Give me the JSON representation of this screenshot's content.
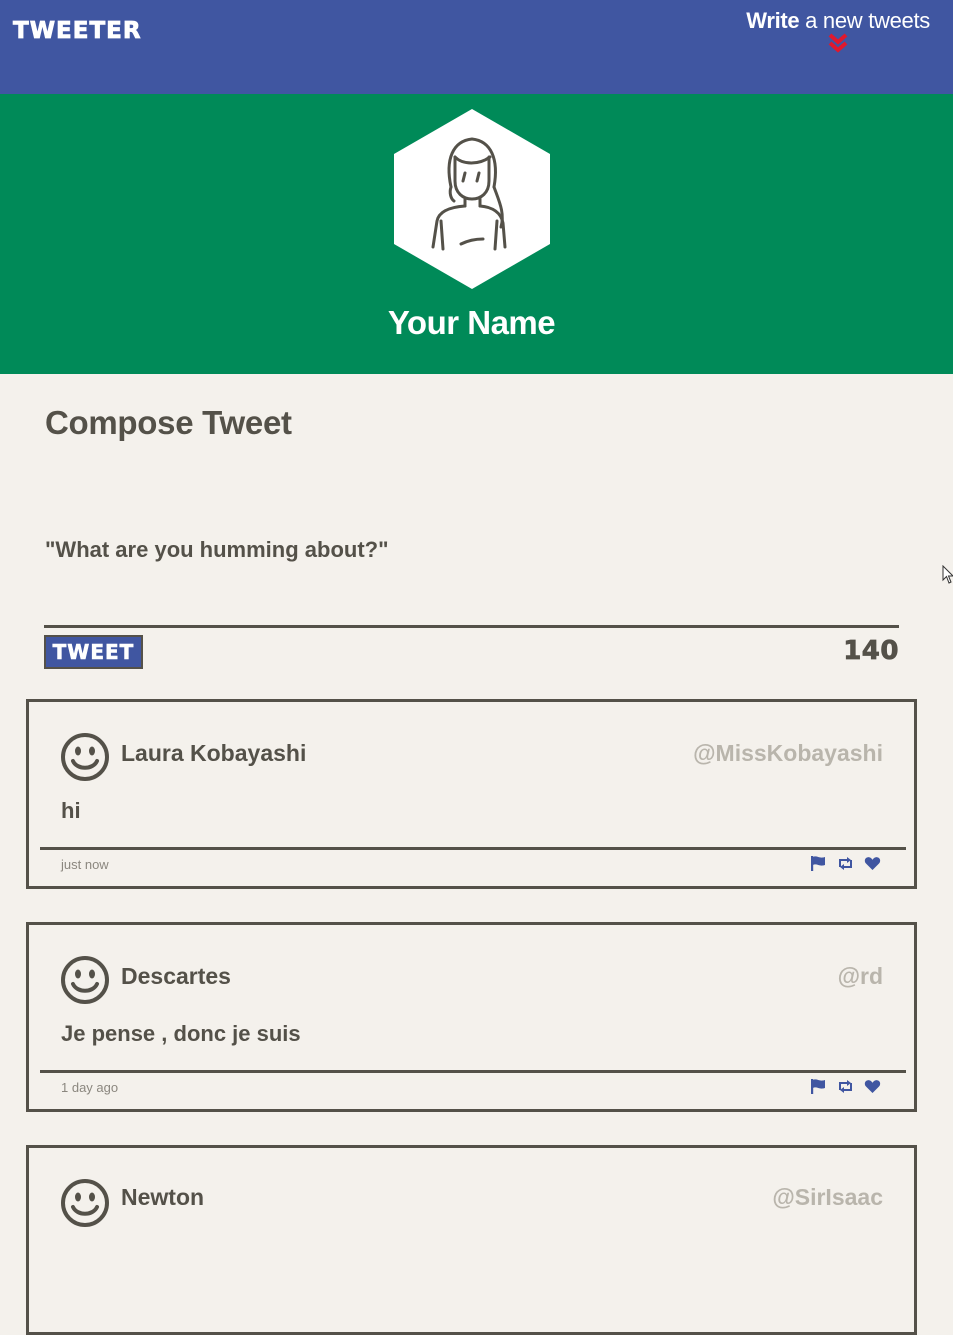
{
  "nav": {
    "brand": "TWEETER",
    "write_bold": "Write",
    "write_rest": " a new tweets",
    "chevron_icon": "double-chevron-down-icon",
    "background": "#4056a1"
  },
  "profile": {
    "name": "Your Name",
    "avatar_icon": "user-avatar-icon",
    "background": "#008a58"
  },
  "compose": {
    "title": "Compose Tweet",
    "placeholder": "\"What are you humming about?\"",
    "button_label": "TWEET",
    "counter": "140"
  },
  "tweets": [
    {
      "name": "Laura Kobayashi",
      "handle": "@MissKobayashi",
      "content": "hi",
      "time": "just now",
      "avatar_icon": "smiley-icon"
    },
    {
      "name": "Descartes",
      "handle": "@rd",
      "content": "Je pense , donc je suis",
      "time": "1 day ago",
      "avatar_icon": "smiley-icon"
    },
    {
      "name": "Newton",
      "handle": "@SirIsaac",
      "content": "",
      "time": "",
      "avatar_icon": "smiley-icon"
    }
  ],
  "actions": [
    "flag-icon",
    "retweet-icon",
    "heart-icon"
  ],
  "colors": {
    "accent": "#4056a1",
    "profile_green": "#008a58",
    "page_bg": "#f4f1ec",
    "text_dark": "#545149",
    "handle_gray": "#b9b5ac",
    "chevron_red": "#e0182d"
  }
}
